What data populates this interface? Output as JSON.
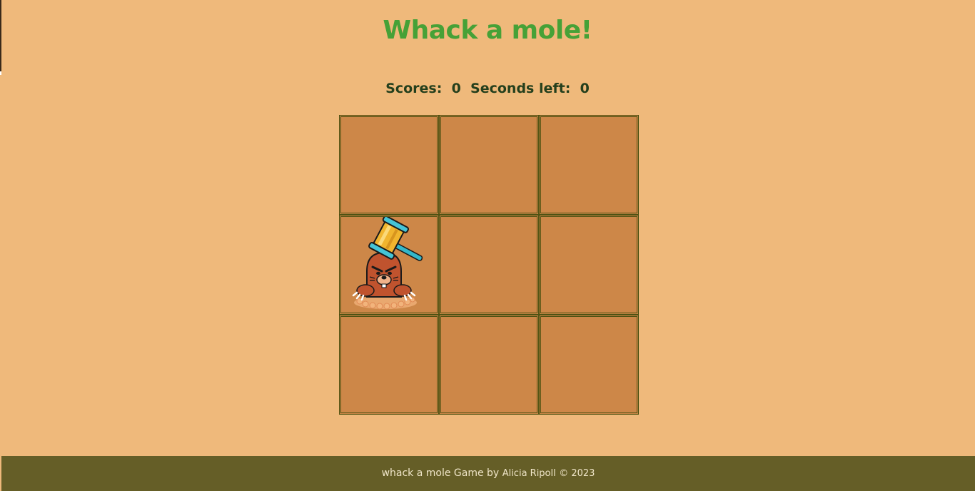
{
  "header": {
    "title": "Whack a mole!"
  },
  "status": {
    "scores_label": "Scores:",
    "scores_value": "0",
    "seconds_label": "Seconds left:",
    "seconds_value": "0"
  },
  "board": {
    "rows": 3,
    "cols": 3,
    "mole_cell": 4,
    "cells": [
      {
        "id": "1"
      },
      {
        "id": "2"
      },
      {
        "id": "3"
      },
      {
        "id": "4"
      },
      {
        "id": "5"
      },
      {
        "id": "6"
      },
      {
        "id": "7"
      },
      {
        "id": "8"
      },
      {
        "id": "9"
      }
    ],
    "cell_color": "#cd8748",
    "border_color": "#4e5212"
  },
  "footer": {
    "text": "whack a mole Game by",
    "author": "Alicia Ripoll",
    "copyright": "© 2023"
  },
  "colors": {
    "background": "#efb97b",
    "title": "#46a137",
    "scoreline": "#243f1c",
    "footer_bg": "#655e27",
    "footer_text": "#efe5c8"
  },
  "icons": [
    "hammer-icon",
    "mole-icon"
  ]
}
